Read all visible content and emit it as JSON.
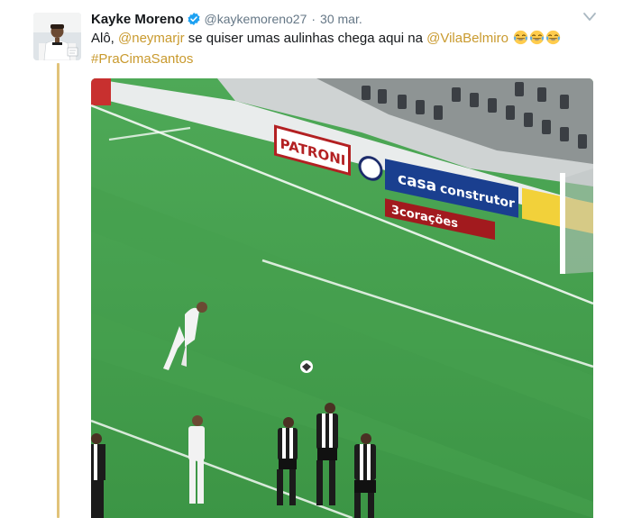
{
  "tweet": {
    "author_name": "Kayke Moreno",
    "author_handle": "@kaykemoreno27",
    "separator": "·",
    "timestamp": "30 mar.",
    "text_prefix": "Alô, ",
    "mention_1": "@neymarjr",
    "text_middle": " se quiser umas aulinhas chega aqui na ",
    "mention_2": "@VilaBelmiro",
    "emojis": [
      "tears-of-joy",
      "tears-of-joy",
      "tears-of-joy"
    ],
    "hashtag": "#PraCimaSantos"
  },
  "media": {
    "type": "video-thumbnail",
    "ad_boards": {
      "patroni": "PATRONI",
      "casa": "casa",
      "construtor": "construtor",
      "coracoes": "3corações"
    }
  },
  "colors": {
    "link": "#c99a2e",
    "thread_line": "#e1c37a",
    "verified": "#1da1f2",
    "muted": "#657786"
  }
}
